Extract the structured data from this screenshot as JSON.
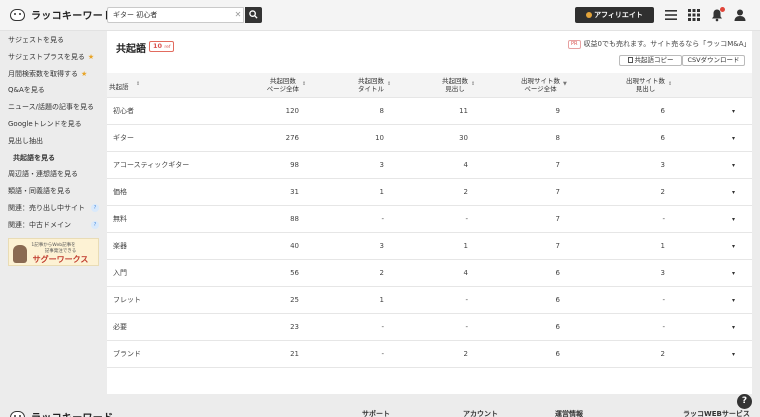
{
  "header": {
    "logo_text": "ラッコキーワード",
    "search_value": "ギター 初心者",
    "affiliate_label": "アフィリエイト"
  },
  "sidebar": {
    "items": [
      {
        "label": "サジェストを見る",
        "star": false
      },
      {
        "label": "サジェストプラスを見る",
        "star": true
      },
      {
        "label": "月間検索数を取得する",
        "star": true
      },
      {
        "label": "Q&Aを見る",
        "star": false
      },
      {
        "label": "ニュース/話題の記事を見る",
        "star": false
      },
      {
        "label": "Googleトレンドを見る",
        "star": false
      },
      {
        "label": "見出し抽出",
        "star": false
      },
      {
        "label": "共起語を見る",
        "star": false,
        "active": true
      },
      {
        "label": "周辺語・連想語を見る",
        "star": false
      },
      {
        "label": "類語・同義語を見る",
        "star": false
      },
      {
        "label": "関連：売り出し中サイト",
        "star": false,
        "badge": "?"
      },
      {
        "label": "関連：中古ドメイン",
        "star": false,
        "badge": "?"
      }
    ],
    "banner": {
      "line1": "1記事からWeb記事を",
      "line2": "記事発注できる",
      "brand": "サグーワークス"
    }
  },
  "main": {
    "title": "共起語",
    "count": "10",
    "count_unit": "ref",
    "pr_tag": "PR",
    "pr_text": "収益0でも売れます。サイト売るなら「ラッコM&A」",
    "copy_label": "共起語コピー",
    "csv_label": "CSVダウンロード"
  },
  "table": {
    "headers": [
      {
        "line1": "共起語",
        "line2": ""
      },
      {
        "line1": "共起回数",
        "line2": "ページ全体"
      },
      {
        "line1": "共起回数",
        "line2": "タイトル"
      },
      {
        "line1": "共起回数",
        "line2": "見出し"
      },
      {
        "line1": "出現サイト数",
        "line2": "ページ全体"
      },
      {
        "line1": "出現サイト数",
        "line2": "見出し"
      }
    ],
    "rows": [
      {
        "keyword": "初心者",
        "c1": "120",
        "c2": "8",
        "c3": "11",
        "c4": "9",
        "c5": "6"
      },
      {
        "keyword": "ギター",
        "c1": "276",
        "c2": "10",
        "c3": "30",
        "c4": "8",
        "c5": "6"
      },
      {
        "keyword": "アコースティックギター",
        "c1": "98",
        "c2": "3",
        "c3": "4",
        "c4": "7",
        "c5": "3"
      },
      {
        "keyword": "価格",
        "c1": "31",
        "c2": "1",
        "c3": "2",
        "c4": "7",
        "c5": "2"
      },
      {
        "keyword": "無料",
        "c1": "88",
        "c2": "-",
        "c3": "-",
        "c4": "7",
        "c5": "-"
      },
      {
        "keyword": "楽器",
        "c1": "40",
        "c2": "3",
        "c3": "1",
        "c4": "7",
        "c5": "1"
      },
      {
        "keyword": "入門",
        "c1": "56",
        "c2": "2",
        "c3": "4",
        "c4": "6",
        "c5": "3"
      },
      {
        "keyword": "フレット",
        "c1": "25",
        "c2": "1",
        "c3": "-",
        "c4": "6",
        "c5": "-"
      },
      {
        "keyword": "必要",
        "c1": "23",
        "c2": "-",
        "c3": "-",
        "c4": "6",
        "c5": "-"
      },
      {
        "keyword": "ブランド",
        "c1": "21",
        "c2": "-",
        "c3": "2",
        "c4": "6",
        "c5": "2"
      }
    ]
  },
  "footer": {
    "logo_text": "ラッコキーワード",
    "support": "サポート",
    "account": "アカウント",
    "company": "運営情報",
    "services": "ラッコWEBサービス",
    "help": "?"
  },
  "colors": {
    "accent_red": "#d9534f",
    "star": "#e8a427",
    "dark": "#2f2f2f"
  }
}
